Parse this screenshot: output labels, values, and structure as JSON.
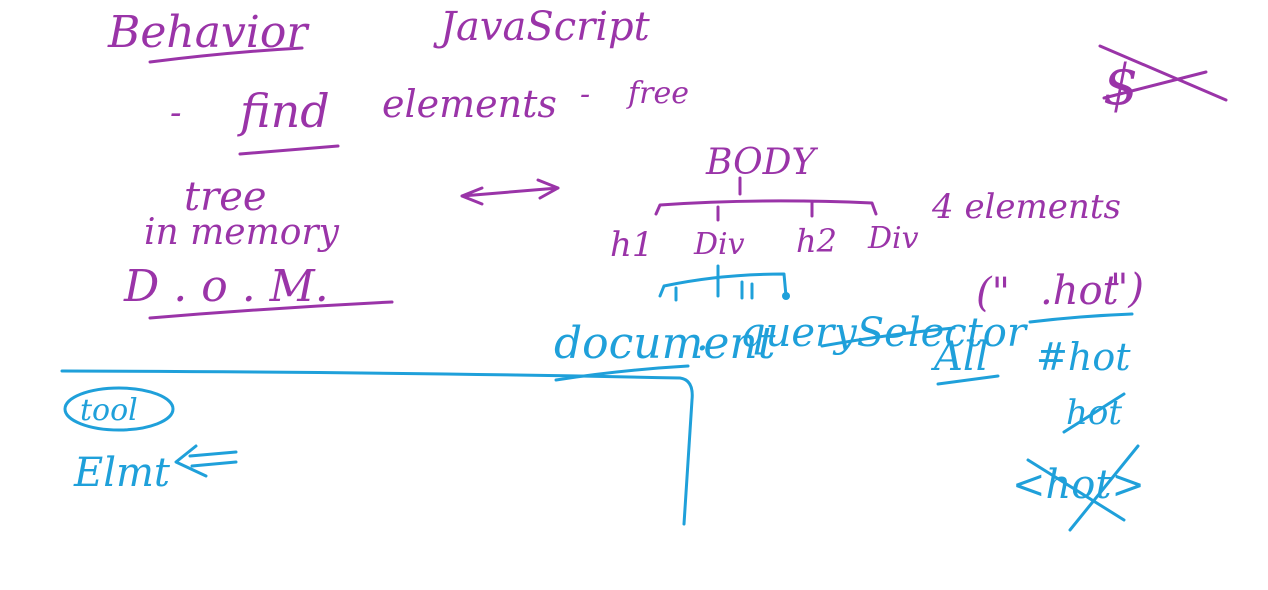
{
  "colors": {
    "purple_ink": "#9a34a8",
    "blue_ink": "#1fa0da",
    "background": "#ffffff"
  },
  "notes": {
    "behavior": "Behavior",
    "javascript": "JavaScript",
    "find_dash": "-",
    "find": "find",
    "elements": "elements",
    "free_dash": "-",
    "free": "free",
    "tree": "tree",
    "in_memory": "in memory",
    "dom": "D . o . M.",
    "body": "BODY",
    "h1": "h1",
    "div1": "Div",
    "h2": "h2",
    "div2": "Div",
    "elements_count": "4 elements",
    "document": "document",
    "dot": ".",
    "query_selector": "querySelector",
    "all": "All",
    "arg_open": "(\"",
    "arg_hot": ".hot",
    "arg_close": "\")",
    "hash_hot": "#hot",
    "hot_struck": "hot",
    "hot_crossed": "<hot>",
    "tool": "tool",
    "elements_short": "Elmt"
  }
}
